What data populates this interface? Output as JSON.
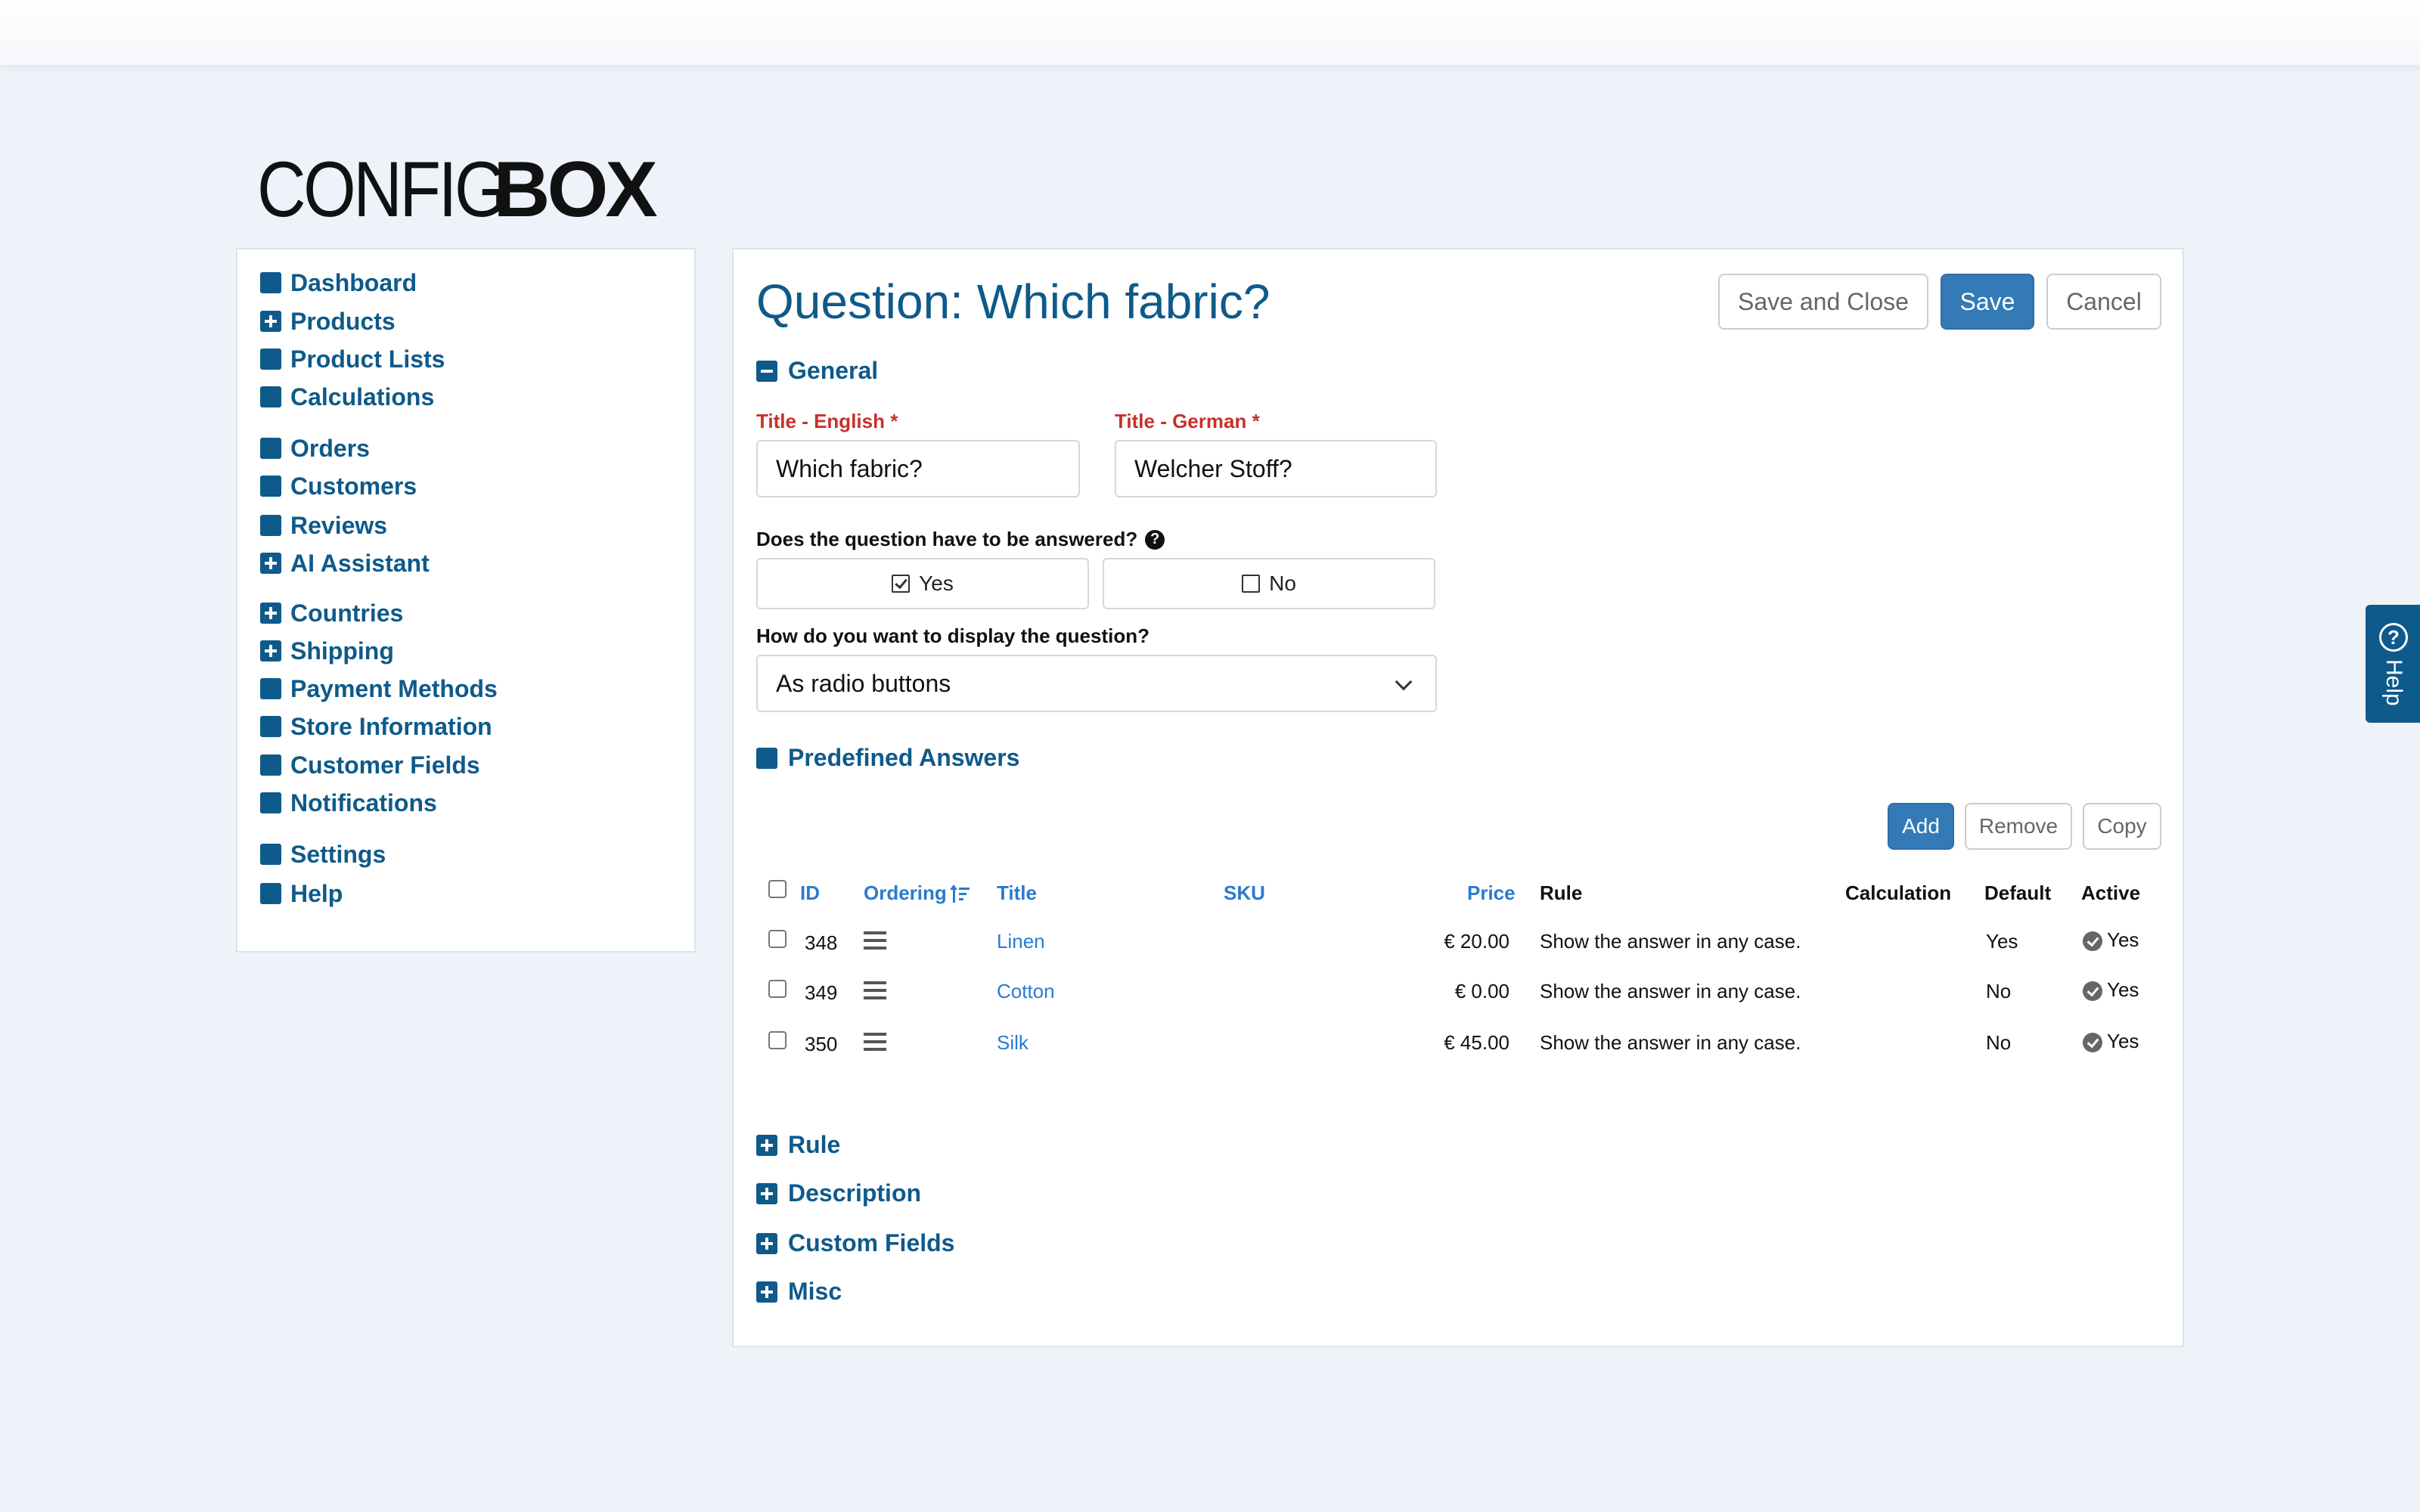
{
  "brand": {
    "logo_light": "CONFIG",
    "logo_bold": "BOX"
  },
  "sidebar": {
    "items": [
      {
        "label": "Dashboard",
        "icon": "square-icon"
      },
      {
        "label": "Products",
        "icon": "plus-square-icon"
      },
      {
        "label": "Product Lists",
        "icon": "square-icon"
      },
      {
        "label": "Calculations",
        "icon": "square-icon"
      },
      {
        "label": "Orders",
        "icon": "square-icon"
      },
      {
        "label": "Customers",
        "icon": "square-icon"
      },
      {
        "label": "Reviews",
        "icon": "square-icon"
      },
      {
        "label": "AI Assistant",
        "icon": "plus-square-icon"
      },
      {
        "label": "Countries",
        "icon": "plus-square-icon"
      },
      {
        "label": "Shipping",
        "icon": "plus-square-icon"
      },
      {
        "label": "Payment Methods",
        "icon": "square-icon"
      },
      {
        "label": "Store Information",
        "icon": "square-icon"
      },
      {
        "label": "Customer Fields",
        "icon": "square-icon"
      },
      {
        "label": "Notifications",
        "icon": "square-icon"
      },
      {
        "label": "Settings",
        "icon": "square-icon"
      },
      {
        "label": "Help",
        "icon": "square-icon"
      }
    ]
  },
  "header": {
    "title": "Question: Which fabric?",
    "save_close_label": "Save and Close",
    "save_label": "Save",
    "cancel_label": "Cancel"
  },
  "general": {
    "heading": "General",
    "title_en_label": "Title - English *",
    "title_en_value": "Which fabric?",
    "title_de_label": "Title - German *",
    "title_de_value": "Welcher Stoff?",
    "required_question": "Does the question have to be answered?",
    "yes_label": "Yes",
    "no_label": "No",
    "display_question": "How do you want to display the question?",
    "display_value": "As radio buttons"
  },
  "answers": {
    "heading": "Predefined Answers",
    "add_label": "Add",
    "remove_label": "Remove",
    "copy_label": "Copy",
    "columns": [
      "ID",
      "Ordering",
      "Title",
      "SKU",
      "Price",
      "Rule",
      "Calculation",
      "Default",
      "Active"
    ],
    "rows": [
      {
        "id": "348",
        "title": "Linen",
        "sku": "",
        "price": "€ 20.00",
        "rule": "Show the answer in any case.",
        "calculation": "",
        "default": "Yes",
        "active": "Yes"
      },
      {
        "id": "349",
        "title": "Cotton",
        "sku": "",
        "price": "€ 0.00",
        "rule": "Show the answer in any case.",
        "calculation": "",
        "default": "No",
        "active": "Yes"
      },
      {
        "id": "350",
        "title": "Silk",
        "sku": "",
        "price": "€ 45.00",
        "rule": "Show the answer in any case.",
        "calculation": "",
        "default": "No",
        "active": "Yes"
      }
    ]
  },
  "collapsed_sections": [
    "Rule",
    "Description",
    "Custom Fields",
    "Misc"
  ],
  "help_tab": {
    "label": "Help"
  },
  "colors": {
    "brand": "#0e5a8a",
    "primary_button": "#337ab7",
    "link": "#2a7ad0",
    "required": "#c9302c"
  }
}
